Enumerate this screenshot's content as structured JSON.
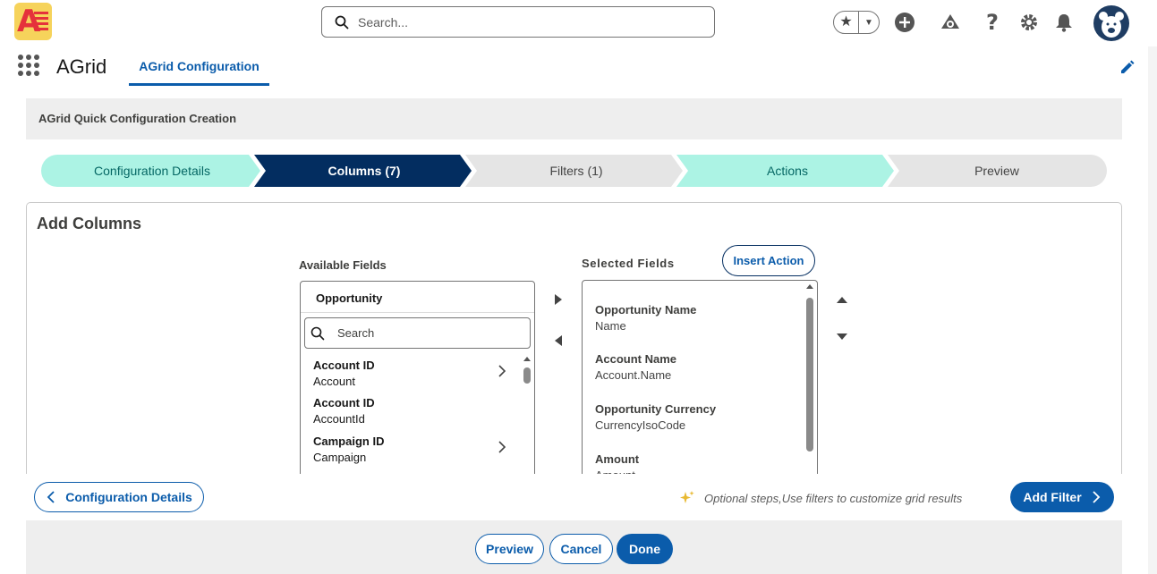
{
  "header": {
    "logo_icon": "agrid-logo-icon",
    "search_placeholder": "Search...",
    "icons": [
      "favorites-star-icon",
      "global-actions-add-icon",
      "trailhead-guide-icon",
      "help-icon",
      "setup-gear-icon",
      "notifications-bell-icon",
      "user-avatar"
    ]
  },
  "context_bar": {
    "app_name": "AGrid",
    "tab": "AGrid Configuration"
  },
  "section": {
    "title": "AGrid Quick Configuration Creation"
  },
  "path": {
    "steps": [
      {
        "label": "Configuration Details",
        "state": "complete"
      },
      {
        "label": "Columns (7)",
        "state": "current"
      },
      {
        "label": "Filters (1)",
        "state": "incomplete"
      },
      {
        "label": "Actions",
        "state": "complete"
      },
      {
        "label": "Preview",
        "state": "incomplete"
      }
    ]
  },
  "card": {
    "title": "Add Columns",
    "available": {
      "label": "Available Fields",
      "object_name": "Opportunity",
      "search_placeholder": "Search",
      "items": [
        {
          "label": "Account ID",
          "api": "Account",
          "has_children": true
        },
        {
          "label": "Account ID",
          "api": "AccountId",
          "has_children": false
        },
        {
          "label": "Campaign ID",
          "api": "Campaign",
          "has_children": true
        }
      ]
    },
    "selected": {
      "label": "Selected Fields",
      "insert_action": "Insert Action",
      "items": [
        {
          "label": "Opportunity Name",
          "api": "Name"
        },
        {
          "label": "Account Name",
          "api": "Account.Name"
        },
        {
          "label": "Opportunity Currency",
          "api": "CurrencyIsoCode"
        },
        {
          "label": "Amount",
          "api": "Amount"
        }
      ]
    }
  },
  "footer": {
    "back_label": "Configuration Details",
    "hint": "Optional steps,Use filters to customize grid results",
    "next_label": "Add Filter"
  },
  "actions": {
    "preview": "Preview",
    "cancel": "Cancel",
    "done": "Done"
  },
  "colors": {
    "brand": "#0b5cab",
    "path_current": "#032d60",
    "path_complete": "#acf3e4",
    "path_incomplete": "#e5e5e5"
  }
}
